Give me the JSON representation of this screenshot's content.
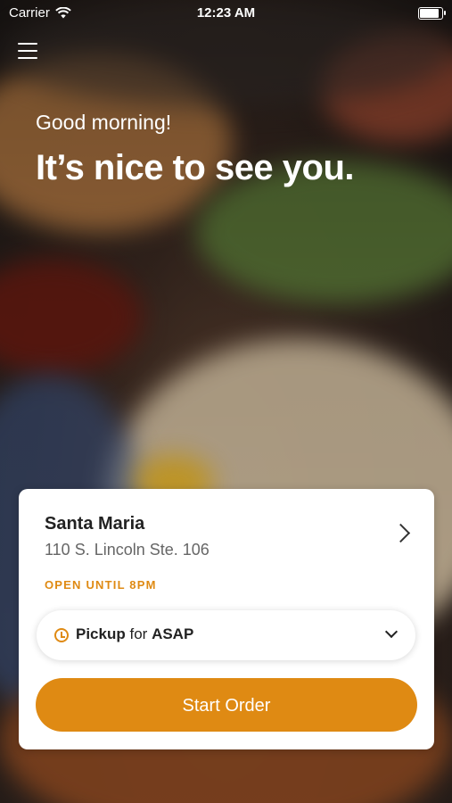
{
  "status_bar": {
    "carrier": "Carrier",
    "time": "12:23 AM",
    "battery_level": 0.95
  },
  "header": {
    "greeting": "Good morning!",
    "headline": "It’s nice to see you."
  },
  "location_card": {
    "name": "Santa Maria",
    "address": "110 S. Lincoln Ste. 106",
    "hours": "OPEN UNTIL 8PM",
    "pickup": {
      "mode": "Pickup",
      "connector": "for",
      "time": "ASAP"
    },
    "start_order_label": "Start Order"
  },
  "colors": {
    "accent": "#df8a13",
    "card_bg": "#ffffff",
    "text_dark": "#222222",
    "text_muted": "#666666"
  },
  "icons": [
    "wifi-icon",
    "battery-icon",
    "menu-icon",
    "chevron-right-icon",
    "clock-icon",
    "chevron-down-icon"
  ]
}
